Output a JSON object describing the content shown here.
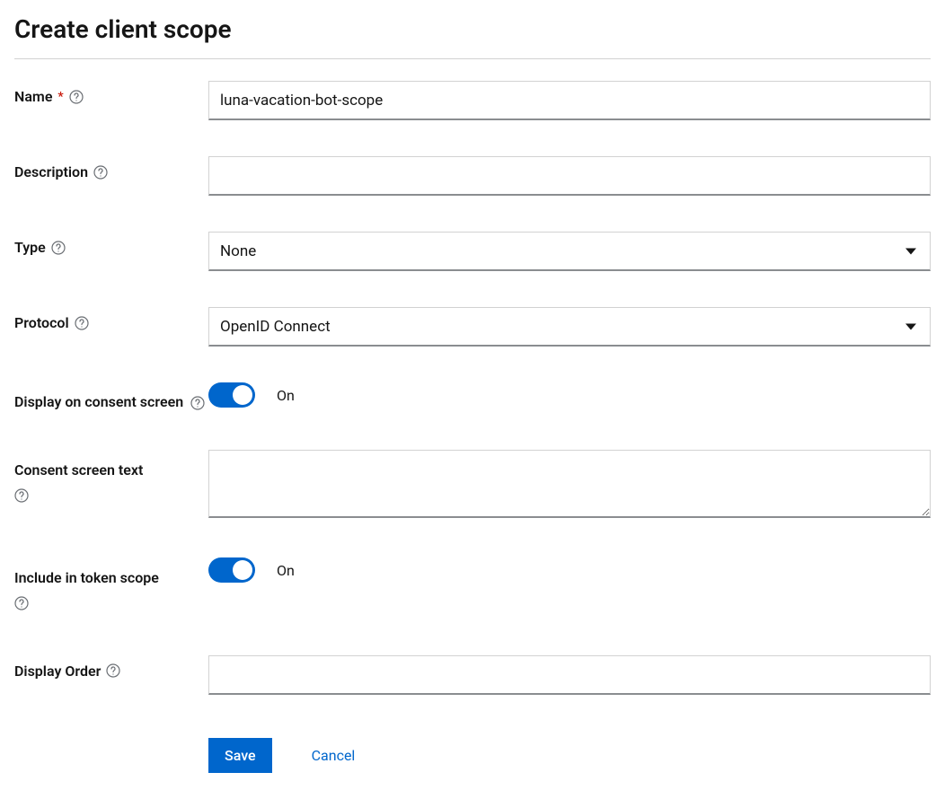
{
  "page": {
    "title": "Create client scope"
  },
  "fields": {
    "name": {
      "label": "Name",
      "required": true,
      "value": "luna-vacation-bot-scope"
    },
    "description": {
      "label": "Description",
      "value": ""
    },
    "type": {
      "label": "Type",
      "value": "None"
    },
    "protocol": {
      "label": "Protocol",
      "value": "OpenID Connect"
    },
    "displayOnConsent": {
      "label": "Display on consent screen",
      "status": "On"
    },
    "consentScreenText": {
      "label": "Consent screen text",
      "value": ""
    },
    "includeInTokenScope": {
      "label": "Include in token scope",
      "status": "On"
    },
    "displayOrder": {
      "label": "Display Order",
      "value": ""
    }
  },
  "buttons": {
    "save": "Save",
    "cancel": "Cancel"
  }
}
